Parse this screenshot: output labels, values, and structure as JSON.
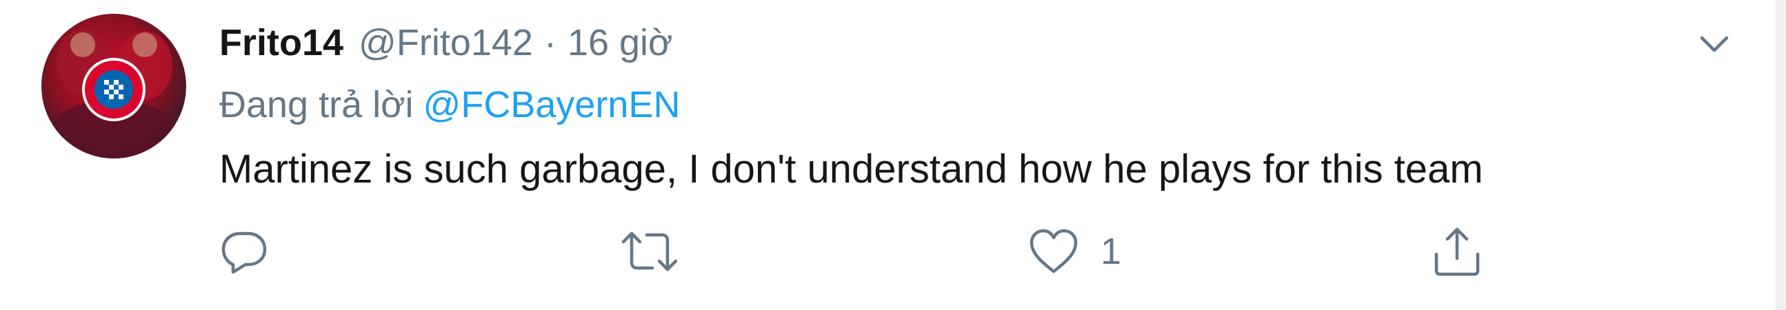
{
  "tweet": {
    "display_name": "Frito14",
    "handle": "@Frito142",
    "separator": "·",
    "time": "16 giờ",
    "reply_prefix": "Đang trả lời",
    "reply_to": "@FCBayernEN",
    "text": "Martinez is such garbage, I don't understand how he plays for this team",
    "avatar_icon": "bayern-crest-avatar",
    "menu_icon": "chevron-down-icon",
    "actions": {
      "reply": {
        "icon": "reply-icon",
        "count": ""
      },
      "retweet": {
        "icon": "retweet-icon",
        "count": ""
      },
      "like": {
        "icon": "heart-icon",
        "count": "1"
      },
      "share": {
        "icon": "share-icon",
        "count": ""
      }
    }
  },
  "colors": {
    "text_primary": "#14171a",
    "text_secondary": "#657786",
    "link": "#1da1f2",
    "icon": "#657786"
  }
}
